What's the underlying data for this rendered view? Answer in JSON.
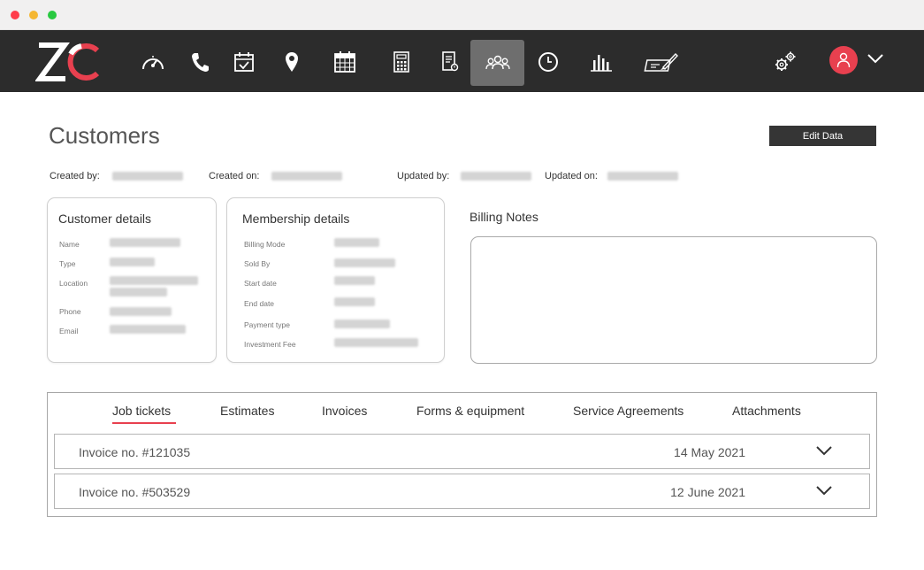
{
  "colors": {
    "accent": "#e8404f",
    "navbar_bg": "#2c2c2c",
    "active_nav_bg": "#6e6e6e"
  },
  "logo": {
    "text": "ZC"
  },
  "nav": {
    "items": [
      {
        "name": "dashboard",
        "icon": "speedometer-icon"
      },
      {
        "name": "calls",
        "icon": "phone-icon"
      },
      {
        "name": "tasks",
        "icon": "calendar-check-icon"
      },
      {
        "name": "locations",
        "icon": "map-pin-icon"
      },
      {
        "name": "schedule",
        "icon": "calendar-grid-icon"
      },
      {
        "name": "calculator",
        "icon": "calculator-icon"
      },
      {
        "name": "documents",
        "icon": "document-icon"
      },
      {
        "name": "customers",
        "icon": "users-icon",
        "active": true
      },
      {
        "name": "time",
        "icon": "clock-icon"
      },
      {
        "name": "reports",
        "icon": "bar-chart-icon"
      },
      {
        "name": "checks",
        "icon": "check-pen-icon"
      }
    ],
    "settings_icon": "gears-icon",
    "avatar_icon": "user-icon",
    "avatar_menu_icon": "chevron-down-icon"
  },
  "page": {
    "title": "Customers",
    "edit_button": "Edit Data",
    "meta": {
      "created_by_label": "Created by:",
      "created_on_label": "Created on:",
      "updated_by_label": "Updated by:",
      "updated_on_label": "Updated on:"
    }
  },
  "customer_details": {
    "title": "Customer details",
    "fields": [
      "Name",
      "Type",
      "Location",
      "Phone",
      "Email"
    ]
  },
  "membership_details": {
    "title": "Membership details",
    "fields": [
      "Billing Mode",
      "Sold By",
      "Start date",
      "End date",
      "Payment type",
      "Investment Fee"
    ]
  },
  "billing_notes": {
    "title": "Billing Notes"
  },
  "tabs": {
    "items": [
      "Job tickets",
      "Estimates",
      "Invoices",
      "Forms & equipment",
      "Service Agreements",
      "Attachments"
    ],
    "active": "Job tickets"
  },
  "rows": [
    {
      "label": "Invoice no. #121035",
      "date": "14 May 2021"
    },
    {
      "label": "Invoice no. #503529",
      "date": "12 June 2021"
    }
  ]
}
